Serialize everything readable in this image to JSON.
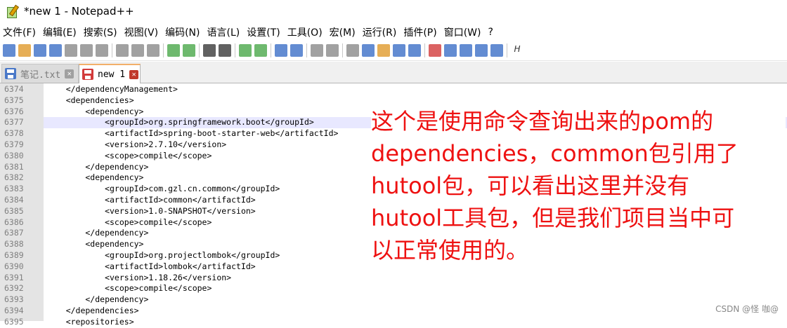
{
  "window": {
    "title": "*new 1 - Notepad++"
  },
  "menu": [
    "文件(F)",
    "编辑(E)",
    "搜索(S)",
    "视图(V)",
    "编码(N)",
    "语言(L)",
    "设置(T)",
    "工具(O)",
    "宏(M)",
    "运行(R)",
    "插件(P)",
    "窗口(W)",
    "?"
  ],
  "toolbar": {
    "icons": [
      "new-icon",
      "open-icon",
      "save-icon",
      "save-all-icon",
      "close-icon",
      "close-all-icon",
      "print-icon",
      "sep",
      "cut-icon",
      "copy-icon",
      "paste-icon",
      "sep",
      "undo-icon",
      "redo-icon",
      "sep",
      "find-icon",
      "replace-icon",
      "sep",
      "zoom-in-icon",
      "zoom-out-icon",
      "sep",
      "sync-v-icon",
      "sync-h-icon",
      "sep",
      "word-wrap-icon",
      "show-all-chars-icon",
      "sep",
      "indent-guide-icon",
      "doc-map-icon",
      "function-list-icon",
      "folder-workspace-icon",
      "monitor-icon",
      "sep",
      "record-macro-icon",
      "stop-macro-icon",
      "play-macro-icon",
      "run-macro-icon",
      "save-macro-icon",
      "sep",
      "spell-check-icon"
    ],
    "colors": {
      "blue": "#3c6fc7",
      "green": "#4aa84a",
      "red": "#d23b3b",
      "gray": "#8a8a8a",
      "orange": "#e09a2c"
    }
  },
  "tabs": [
    {
      "label": "笔记.txt",
      "active": false,
      "icon": "floppy-blue-icon",
      "color": "#4a78c8"
    },
    {
      "label": "new 1",
      "active": true,
      "icon": "floppy-red-icon",
      "color": "#d23b3b"
    }
  ],
  "editor": {
    "lines": [
      {
        "n": "6374",
        "code": "    </dependencyManagement>"
      },
      {
        "n": "6375",
        "code": "    <dependencies>"
      },
      {
        "n": "6376",
        "code": "        <dependency>"
      },
      {
        "n": "6377",
        "code": "            <groupId>org.springframework.boot</groupId>",
        "current": true
      },
      {
        "n": "6378",
        "code": "            <artifactId>spring-boot-starter-web</artifactId>"
      },
      {
        "n": "6379",
        "code": "            <version>2.7.10</version>"
      },
      {
        "n": "6380",
        "code": "            <scope>compile</scope>"
      },
      {
        "n": "6381",
        "code": "        </dependency>"
      },
      {
        "n": "6382",
        "code": "        <dependency>"
      },
      {
        "n": "6383",
        "code": "            <groupId>com.gzl.cn.common</groupId>"
      },
      {
        "n": "6384",
        "code": "            <artifactId>common</artifactId>"
      },
      {
        "n": "6385",
        "code": "            <version>1.0-SNAPSHOT</version>"
      },
      {
        "n": "6386",
        "code": "            <scope>compile</scope>"
      },
      {
        "n": "6387",
        "code": "        </dependency>"
      },
      {
        "n": "6388",
        "code": "        <dependency>"
      },
      {
        "n": "6389",
        "code": "            <groupId>org.projectlombok</groupId>"
      },
      {
        "n": "6390",
        "code": "            <artifactId>lombok</artifactId>"
      },
      {
        "n": "6391",
        "code": "            <version>1.18.26</version>"
      },
      {
        "n": "6392",
        "code": "            <scope>compile</scope>"
      },
      {
        "n": "6393",
        "code": "        </dependency>"
      },
      {
        "n": "6394",
        "code": "    </dependencies>"
      },
      {
        "n": "6395",
        "code": "    <repositories>"
      }
    ]
  },
  "annotation": {
    "lines": [
      "这个是使用命令查询出来的pom的",
      "dependencies，common包引用了",
      "hutool包，可以看出这里并没有",
      "hutool工具包，但是我们项目当中可",
      "以正常使用的。"
    ]
  },
  "watermark": "CSDN @怪 咖@"
}
